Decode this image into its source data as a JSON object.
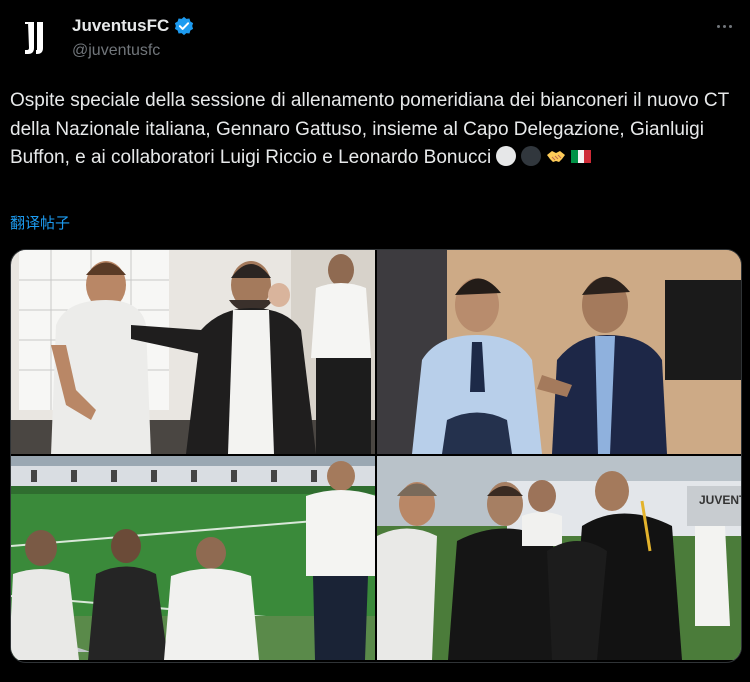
{
  "tweet": {
    "display_name": "JuventusFC",
    "handle": "@juventusfc",
    "verified_icon": "verified-badge-icon",
    "text": "Ospite speciale della sessione di allenamento pomeridiana dei bianconeri il nuovo CT della Nazionale italiana, Gennaro Gattuso, insieme al Capo Delegazione, Gianluigi Buffon, e ai collaboratori Luigi Riccio e Leonardo Bonucci",
    "emojis": [
      "white-circle-icon",
      "black-circle-icon",
      "handshake-icon",
      "italy-flag-icon"
    ],
    "translate_label": "翻译帖子",
    "more_icon": "more-options-icon"
  },
  "media": {
    "photos": [
      {
        "name": "photo-gattuso-greeting"
      },
      {
        "name": "photo-buffon-conversation"
      },
      {
        "name": "photo-training-pitch"
      },
      {
        "name": "photo-embrace"
      }
    ],
    "stadium_sign": "JUVENTUS"
  }
}
